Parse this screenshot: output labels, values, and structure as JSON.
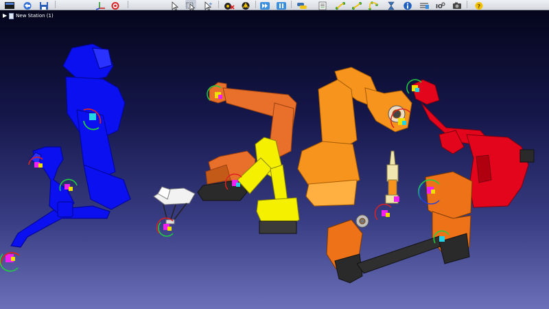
{
  "toolbar": {
    "icons": [
      "new-station-icon",
      "open-station-icon",
      "save-station-icon",
      "reference-frame-icon",
      "target-icon",
      "select-cursor-icon",
      "select-multiple-icon",
      "select-add-icon",
      "collision-check-icon",
      "collision-off-icon",
      "run-program-icon",
      "pause-icon",
      "python-icon",
      "program-list-icon",
      "move-joints-icon",
      "move-linear-icon",
      "move-circular-icon",
      "wait-icon",
      "info-icon",
      "report-icon",
      "io-icon",
      "camera-icon",
      "help-icon"
    ]
  },
  "tree": {
    "expand_icon": "triangle-right-icon",
    "station_icon": "station-icon",
    "station_label": "New Station (1)"
  },
  "scene": {
    "background_top": "#05051c",
    "background_bottom": "#6b70b8",
    "objects": [
      {
        "name": "blue-robot",
        "color": "#0a10f0"
      },
      {
        "name": "small-blue-robot",
        "color": "#1820e0"
      },
      {
        "name": "kuka-orange-robot",
        "color": "#e8702a"
      },
      {
        "name": "yellow-robot",
        "color": "#f5f000"
      },
      {
        "name": "large-orange-robot",
        "color": "#f7941d"
      },
      {
        "name": "red-robot",
        "color": "#e3051b"
      },
      {
        "name": "white-delta-robot",
        "color": "#f2f2f2"
      },
      {
        "name": "spindle-tool",
        "color": "#f0e6b0"
      },
      {
        "name": "positioner-table",
        "color": "#ee7318"
      }
    ]
  }
}
